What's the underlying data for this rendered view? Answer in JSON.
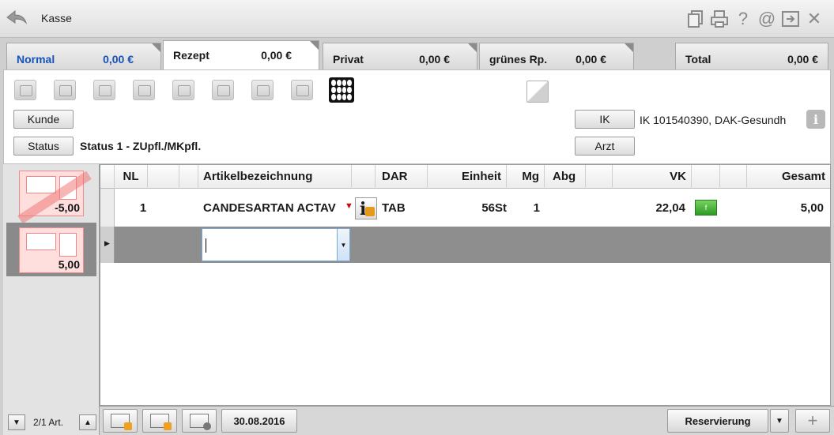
{
  "window": {
    "title": "Kasse"
  },
  "toolbar": {
    "icons": [
      "copy-icon",
      "print-icon",
      "help-icon",
      "at-icon",
      "window-icon",
      "close-icon"
    ],
    "help_glyph": "?",
    "at_glyph": "@",
    "close_glyph": "✕"
  },
  "tabs": [
    {
      "label": "Normal",
      "amount": "0,00 €"
    },
    {
      "label": "Rezept",
      "amount": "0,00 €"
    },
    {
      "label": "Privat",
      "amount": "0,00 €"
    },
    {
      "label": "grünes Rp.",
      "amount": "0,00 €"
    }
  ],
  "total": {
    "label": "Total",
    "amount": "0,00 €"
  },
  "panel": {
    "icons": [
      "card-icon",
      "handshake-icon",
      "printer-icon",
      "people-icon",
      "percent-icon",
      "sun-icon",
      "document-person-icon",
      "scan-icon",
      "keypad-icon"
    ],
    "kunde_label": "Kunde",
    "status_label": "Status",
    "status_text": "Status 1 - ZUpfl./MKpfl.",
    "ik_label": "IK",
    "ik_text": "IK 101540390, DAK-Gesundh",
    "arzt_label": "Arzt",
    "info_glyph": "i"
  },
  "receipts": [
    {
      "value": "-5,00",
      "cancelled": true
    },
    {
      "value": "5,00",
      "cancelled": false
    }
  ],
  "left_nav": {
    "count": "2/1 Art."
  },
  "grid": {
    "columns": [
      "NL",
      "Artikelbezeichnung",
      "DAR",
      "Einheit",
      "Mg",
      "Abg",
      "VK",
      "Gesamt"
    ],
    "rows": [
      {
        "nl": "1",
        "name": "CANDESARTAN ACTAV",
        "dar": "TAB",
        "einheit": "56St",
        "mg": "1",
        "abg": "",
        "vk": "22,04",
        "badge": "f",
        "gesamt": "5,00"
      }
    ],
    "info_glyph": "i"
  },
  "statusbar": {
    "date": "30.08.2016",
    "reservierung": "Reservierung"
  }
}
